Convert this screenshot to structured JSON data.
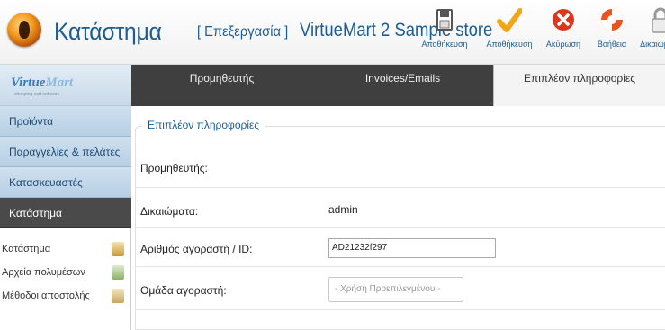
{
  "header": {
    "title": "Κατάστημα",
    "subtitle": "[ Επεξεργασία ]",
    "store": "VirtueMart 2 Sample store"
  },
  "toolbar": [
    {
      "label": "Αποθήκευση",
      "icon": "save-icon"
    },
    {
      "label": "Αποθήκευση",
      "icon": "checkmark-icon"
    },
    {
      "label": "Ακύρωση",
      "icon": "cancel-icon"
    },
    {
      "label": "Βοήθεια",
      "icon": "help-icon"
    },
    {
      "label": "Δικαιώματα",
      "icon": "lock-icon"
    }
  ],
  "sidebar": {
    "logo": {
      "main": "Virtue",
      "accent": "Mart",
      "tagline": "shopping cart software"
    },
    "menu": [
      {
        "label": "Προϊόντα"
      },
      {
        "label": "Παραγγελίες & πελάτες"
      },
      {
        "label": "Κατασκευαστές"
      },
      {
        "label": "Κατάστημα",
        "active": true
      }
    ],
    "sub_items": [
      {
        "label": "Κατάστημα",
        "icon": "store-icon"
      },
      {
        "label": "Αρχεία πολυμέσων",
        "icon": "media-icon"
      },
      {
        "label": "Μέθοδοι αποστολής",
        "icon": "shipping-icon"
      }
    ]
  },
  "tabs": [
    {
      "label": "Προμηθευτής"
    },
    {
      "label": "Invoices/Emails"
    },
    {
      "label": "Επιπλέον πληροφορίες",
      "active": true
    }
  ],
  "form": {
    "legend": "Επιπλέον πληροφορίες",
    "vendor_label": "Προμηθευτής:",
    "permissions_label": "Δικαιώματα:",
    "permissions_value": "admin",
    "customer_id_label": "Αριθμός αγοραστή / ID:",
    "customer_id_value": "AD21232f297",
    "customer_group_label": "Ομάδα αγοραστή:",
    "customer_group_placeholder": "- Χρήση Προεπιλεγμένου -"
  }
}
